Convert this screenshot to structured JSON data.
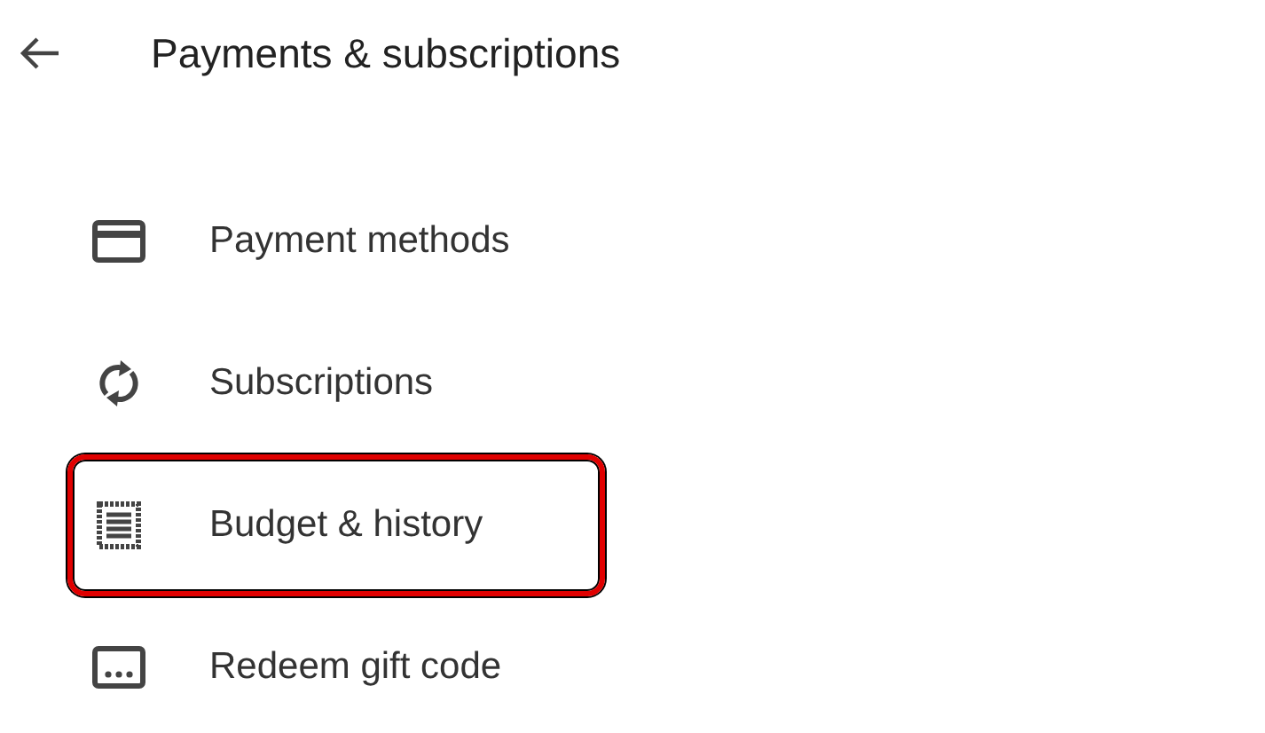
{
  "header": {
    "title": "Payments & subscriptions"
  },
  "items": [
    {
      "label": "Payment methods",
      "kind": "card",
      "highlighted": false
    },
    {
      "label": "Subscriptions",
      "kind": "sync",
      "highlighted": false
    },
    {
      "label": "Budget & history",
      "kind": "receipt",
      "highlighted": true
    },
    {
      "label": "Redeem gift code",
      "kind": "redeem",
      "highlighted": false
    }
  ]
}
